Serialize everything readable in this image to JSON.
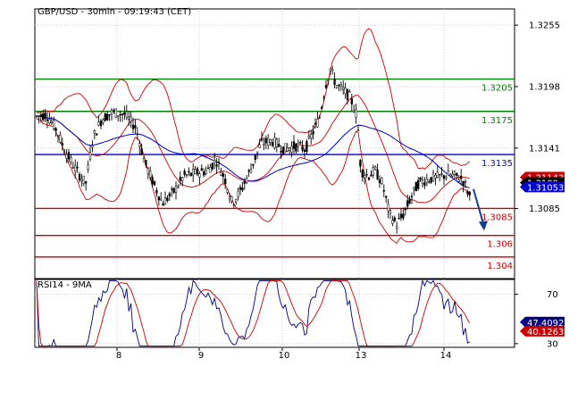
{
  "chart_data": [
    {
      "type": "candlestick",
      "title": "GBP/USD - 30min - 09:19:43 (CET)",
      "ylim": [
        1.302,
        1.327
      ],
      "y_ticks": [
        {
          "value": 1.3255,
          "label": "1.3255"
        },
        {
          "value": 1.3198,
          "label": "1.3198"
        },
        {
          "value": 1.3141,
          "label": "1.3141"
        },
        {
          "value": 1.3085,
          "label": "1.3085"
        }
      ],
      "x_ticks": [
        {
          "x": 8,
          "label": "8"
        },
        {
          "x": 9,
          "label": "9"
        },
        {
          "x": 10,
          "label": "10"
        },
        {
          "x": 13,
          "label": "13"
        },
        {
          "x": 14,
          "label": "14"
        }
      ],
      "levels": [
        {
          "value": 1.3205,
          "label": "1.3205",
          "color": "#008000"
        },
        {
          "value": 1.3175,
          "label": "1.3175",
          "color": "#008000"
        },
        {
          "value": 1.3135,
          "label": "1.3135",
          "color": "#0000cc"
        },
        {
          "value": 1.3085,
          "label": "1.3085",
          "color": "#cc0000"
        },
        {
          "value": 1.306,
          "label": "1.306",
          "color": "#cc0000"
        },
        {
          "value": 1.304,
          "label": "1.304",
          "color": "#cc0000"
        }
      ],
      "price_badges": [
        {
          "value": 1.3114,
          "label": "1.31143",
          "bg": "#cc0000"
        },
        {
          "value": 1.3109,
          "label": "1.3109",
          "bg": "#000000"
        },
        {
          "value": 1.3105,
          "label": "1.31053",
          "bg": "#0000cc"
        }
      ],
      "forecast_arrow": {
        "from": 1.3103,
        "to": 1.3066,
        "color": "#1a3c8c"
      },
      "colors": {
        "candles": "#000000",
        "bollinger": "#cc0000",
        "moving_average": "#0000cc"
      }
    },
    {
      "type": "line",
      "title": "RSI14 - 9MA",
      "ylim": [
        27,
        82
      ],
      "y_ticks": [
        {
          "value": 70,
          "label": "70"
        },
        {
          "value": 30,
          "label": "30"
        }
      ],
      "series": [
        {
          "values": [],
          "color": "#000080"
        },
        {
          "values": [],
          "color": "#cc0000"
        }
      ],
      "badges": [
        {
          "value": 47.4092,
          "label": "47.4092",
          "bg": "#000080"
        },
        {
          "value": 40.1263,
          "label": "40.1263",
          "bg": "#cc0000"
        }
      ]
    }
  ]
}
